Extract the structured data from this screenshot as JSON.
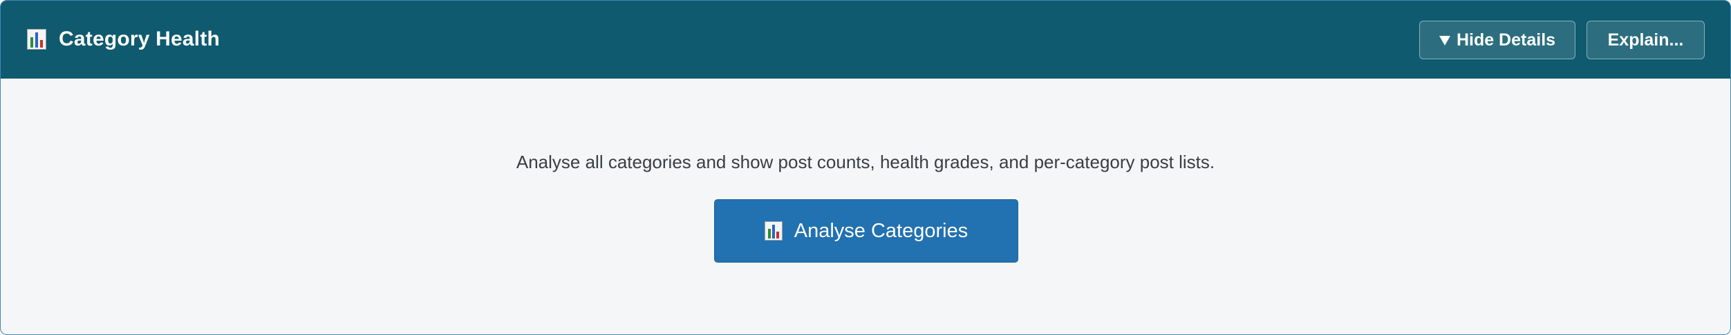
{
  "header": {
    "title": "Category Health",
    "icon": "bar-chart-icon",
    "hide_details_label": "Hide Details",
    "explain_label": "Explain..."
  },
  "main": {
    "description": "Analyse all categories and show post counts, health grades, and per-category post lists.",
    "analyse_label": "Analyse Categories",
    "analyse_icon": "bar-chart-icon"
  },
  "colors": {
    "header_bg": "#0f5a6e",
    "body_bg": "#f5f6f8",
    "primary_button": "#2271b1",
    "text": "#3a3d42"
  }
}
